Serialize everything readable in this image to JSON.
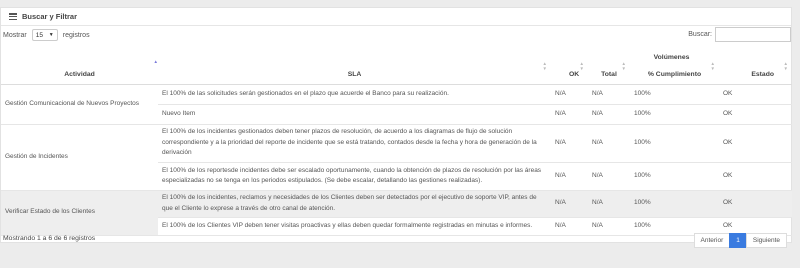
{
  "panel": {
    "title": "Buscar y Filtrar",
    "title_icon": "list-icon"
  },
  "length": {
    "prefix": "Mostrar",
    "value": "15",
    "suffix": "registros"
  },
  "search": {
    "label": "Buscar:"
  },
  "table": {
    "group_header": "Volúmenes",
    "columns": [
      "Actividad",
      "SLA",
      "OK",
      "Total",
      "% Cumplimiento",
      "Estado"
    ],
    "groups": [
      {
        "actividad": "Gestión Comunicacional de Nuevos Proyectos",
        "rows": [
          {
            "sla": "El 100% de las solicitudes serán gestionados en el plazo que acuerde el Banco para su realización.",
            "ok": "N/A",
            "total": "N/A",
            "cumplimiento": "100%",
            "estado": "OK"
          },
          {
            "sla": "Nuevo Item",
            "ok": "N/A",
            "total": "N/A",
            "cumplimiento": "100%",
            "estado": "OK"
          }
        ]
      },
      {
        "actividad": "Gestión de Incidentes",
        "rows": [
          {
            "sla": "El 100% de los incidentes gestionados deben tener plazos de resolución, de acuerdo a los diagramas de flujo de solución correspondiente y a la prioridad del reporte de incidente que se está tratando, contados desde la fecha y hora de generación de la derivación",
            "ok": "N/A",
            "total": "N/A",
            "cumplimiento": "100%",
            "estado": "OK"
          },
          {
            "sla": "El 100% de los reportesde incidentes debe ser escalado oportunamente, cuando la obtención de plazos de resolución por las áreas especializadas no se tenga en los periodos estipulados. (Se debe escalar, detallando las gestiones realizadas).",
            "ok": "N/A",
            "total": "N/A",
            "cumplimiento": "100%",
            "estado": "OK"
          }
        ]
      },
      {
        "actividad": "Verificar Estado de los Clientes",
        "rows": [
          {
            "sla": "El 100% de los incidentes, reclamos y necesidades de los Clientes deben ser detectados por el ejecutivo de soporte VIP, antes de que el Cliente lo exprese a través de otro canal de atención.",
            "ok": "N/A",
            "total": "N/A",
            "cumplimiento": "100%",
            "estado": "OK"
          },
          {
            "sla": "El 100% de los Clientes VIP deben tener visitas proactivas y ellas deben quedar formalmente registradas en minutas e informes.",
            "ok": "N/A",
            "total": "N/A",
            "cumplimiento": "100%",
            "estado": "OK"
          }
        ]
      }
    ]
  },
  "footer": {
    "info": "Mostrando 1 a 6 de 6 registros"
  },
  "pager": {
    "prev": "Anterior",
    "current": "1",
    "next": "Siguiente"
  }
}
